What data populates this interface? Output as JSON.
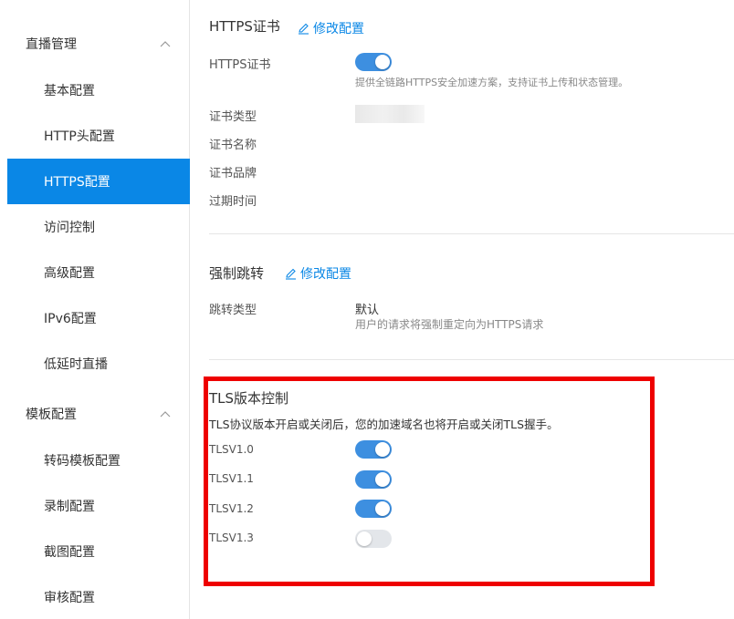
{
  "sidebar": {
    "groups": [
      {
        "label": "直播管理",
        "items": [
          "基本配置",
          "HTTP头配置",
          "HTTPS配置",
          "访问控制",
          "高级配置",
          "IPv6配置",
          "低延时直播"
        ]
      },
      {
        "label": "模板配置",
        "items": [
          "转码模板配置",
          "录制配置",
          "截图配置",
          "审核配置"
        ]
      }
    ],
    "active": "HTTPS配置"
  },
  "https": {
    "title": "HTTPS证书",
    "edit": "修改配置",
    "cert_label": "HTTPS证书",
    "cert_on": true,
    "cert_hint": "提供全链路HTTPS安全加速方案，支持证书上传和状态管理。",
    "type_label": "证书类型",
    "name_label": "证书名称",
    "brand_label": "证书品牌",
    "expire_label": "过期时间"
  },
  "redirect": {
    "title": "强制跳转",
    "edit": "修改配置",
    "type_label": "跳转类型",
    "type_value": "默认",
    "type_hint": "用户的请求将强制重定向为HTTPS请求"
  },
  "tls": {
    "title": "TLS版本控制",
    "desc": "TLS协议版本开启或关闭后，您的加速域名也将开启或关闭TLS握手。",
    "versions": [
      {
        "label": "TLSV1.0",
        "on": true
      },
      {
        "label": "TLSV1.1",
        "on": true
      },
      {
        "label": "TLSV1.2",
        "on": true
      },
      {
        "label": "TLSV1.3",
        "on": false
      }
    ]
  },
  "colors": {
    "accent": "#0a87e6",
    "toggle_on": "#3d8fe0",
    "highlight": "#ee0000"
  },
  "icons": {
    "group_toggle": "chevron-up-icon",
    "edit": "pencil-icon"
  }
}
